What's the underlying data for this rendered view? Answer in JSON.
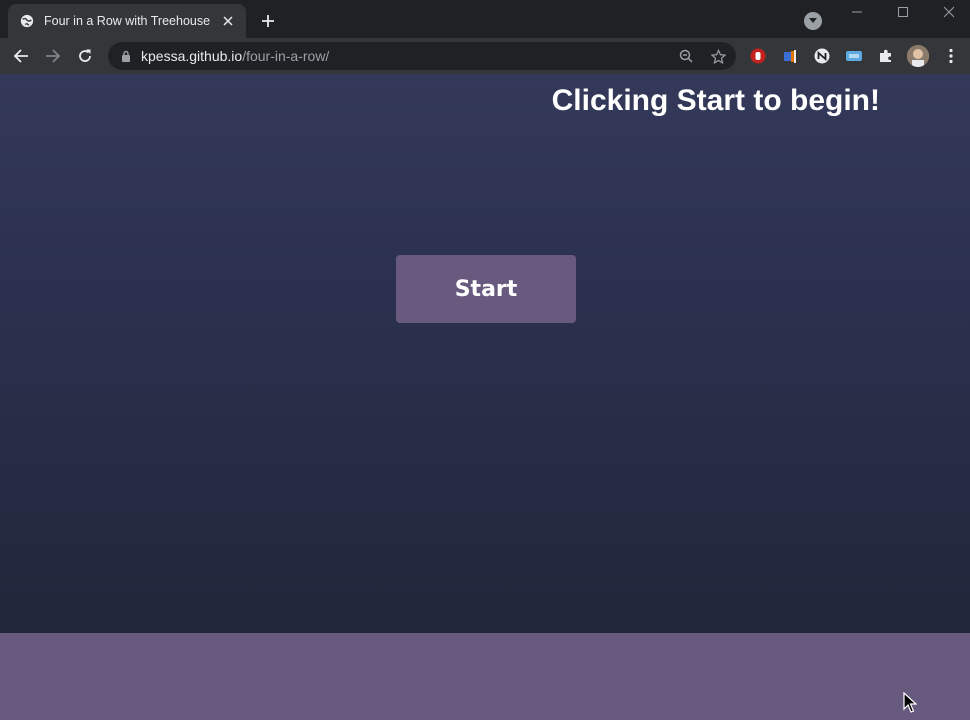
{
  "browser": {
    "tab": {
      "title": "Four in a Row with Treehouse"
    },
    "address": {
      "host": "kpessa.github.io",
      "path": "/four-in-a-row/"
    }
  },
  "page": {
    "status_message": "Clicking Start to begin!",
    "start_button_label": "Start"
  },
  "colors": {
    "accent": "#675a7e",
    "background_top": "#34395a",
    "background_bottom": "#22263a"
  },
  "icons": [
    "globe-icon",
    "close-icon",
    "plus-icon",
    "tab-search-icon",
    "minimize-icon",
    "maximize-icon",
    "window-close-icon",
    "back-icon",
    "forward-icon",
    "reload-icon",
    "lock-icon",
    "zoom-icon",
    "star-icon",
    "extension-hand-icon",
    "extension-flag-icon",
    "extension-n-icon",
    "extension-box-icon",
    "puzzle-icon",
    "profile-avatar",
    "menu-dots-icon",
    "cursor-icon"
  ]
}
